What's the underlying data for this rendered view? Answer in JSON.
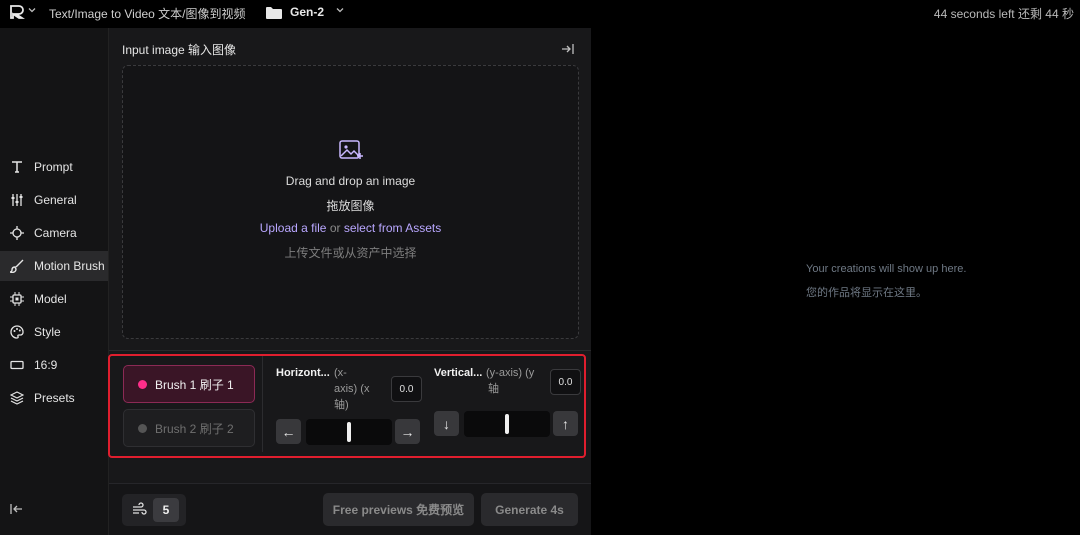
{
  "topbar": {
    "breadcrumb": "Text/Image to Video 文本/图像到视频",
    "project": "Gen-2",
    "time_left": "44 seconds left 还剩 44 秒"
  },
  "sidebar": {
    "items": [
      {
        "label": "Prompt",
        "icon": "text-icon"
      },
      {
        "label": "General",
        "icon": "sliders-icon"
      },
      {
        "label": "Camera",
        "icon": "camera-move-icon"
      },
      {
        "label": "Motion Brush",
        "icon": "brush-icon"
      },
      {
        "label": "Model",
        "icon": "chip-icon"
      },
      {
        "label": "Style",
        "icon": "palette-icon"
      },
      {
        "label": "16:9",
        "icon": "aspect-ratio-icon"
      },
      {
        "label": "Presets",
        "icon": "layers-icon"
      }
    ],
    "active": "Motion Brush"
  },
  "input": {
    "title": "Input image 输入图像",
    "drag": "Drag and drop an image",
    "drag_zh": "拖放图像",
    "upload": "Upload a file",
    "or": "or",
    "select": "select from Assets",
    "upload_zh": "上传文件或从资产中选择"
  },
  "brush": {
    "brush1": "Brush 1 刷子 1",
    "brush2": "Brush 2 刷子 2",
    "horizontal": {
      "title": "Horizont...",
      "sub1": "(x-",
      "sub2": "axis)  (x",
      "sub3": "轴)",
      "value": "0.0"
    },
    "vertical": {
      "title": "Vertical...",
      "sub1": "(y-axis)  (y",
      "sub2": "轴",
      "value": "0.0"
    },
    "arrows": {
      "left": "←",
      "right": "→",
      "down": "↓",
      "up": "↑"
    }
  },
  "bottom": {
    "count": "5",
    "free_previews": "Free previews  免费预览",
    "generate": "Generate 4s"
  },
  "output": {
    "empty_en": "Your creations will show up here.",
    "empty_zh": "您的作品将显示在这里。"
  },
  "colors": {
    "accent_pink": "#ff2e8a",
    "highlight_red": "#e01e2e",
    "link_purple": "#b9a7ff"
  }
}
